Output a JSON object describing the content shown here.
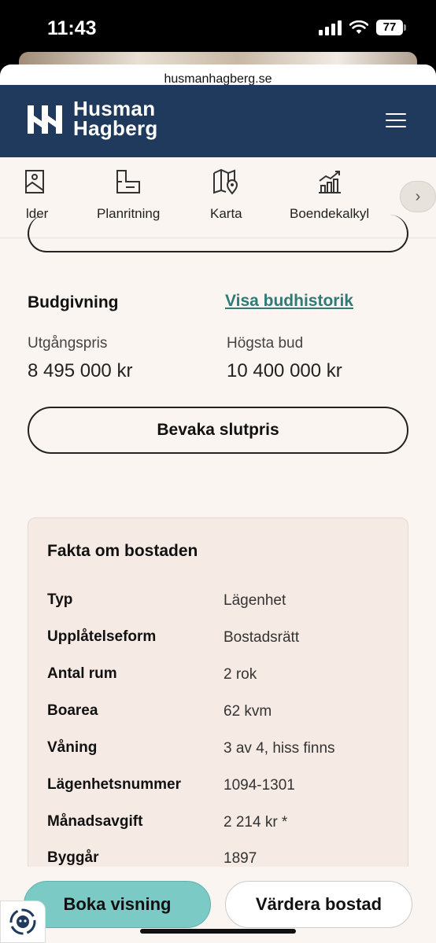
{
  "status_bar": {
    "time": "11:43",
    "battery": "77"
  },
  "browser": {
    "url": "husmanhagberg.se"
  },
  "header": {
    "logo_line1": "Husman",
    "logo_line2": "Hagberg"
  },
  "tabs": [
    {
      "label": "lder",
      "icon": "image-icon"
    },
    {
      "label": "Planritning",
      "icon": "floorplan-icon"
    },
    {
      "label": "Karta",
      "icon": "map-pin-icon"
    },
    {
      "label": "Boendekalkyl",
      "icon": "chart-icon"
    }
  ],
  "bidding": {
    "title": "Budgivning",
    "history_link": "Visa budhistorik",
    "start_price_label": "Utgångspris",
    "start_price": "8 495 000 kr",
    "highest_bid_label": "Högsta bud",
    "highest_bid": "10 400 000 kr",
    "watch_button": "Bevaka slutpris"
  },
  "facts": {
    "title": "Fakta om bostaden",
    "rows": [
      {
        "key": "Typ",
        "value": "Lägenhet"
      },
      {
        "key": "Upplåtelseform",
        "value": "Bostadsrätt"
      },
      {
        "key": "Antal rum",
        "value": "2 rok"
      },
      {
        "key": "Boarea",
        "value": "62 kvm"
      },
      {
        "key": "Våning",
        "value": "3 av 4, hiss finns"
      },
      {
        "key": "Lägenhetsnummer",
        "value": "1094-1301"
      },
      {
        "key": "Månadsavgift",
        "value": "2 214 kr *"
      },
      {
        "key": "Byggår",
        "value": "1897"
      }
    ]
  },
  "actions": {
    "book": "Boka visning",
    "value": "Värdera bostad"
  },
  "colors": {
    "header_bg": "#1f3a5c",
    "page_bg": "#faf5f0",
    "accent": "#7ccac6",
    "link": "#2f7a76"
  }
}
